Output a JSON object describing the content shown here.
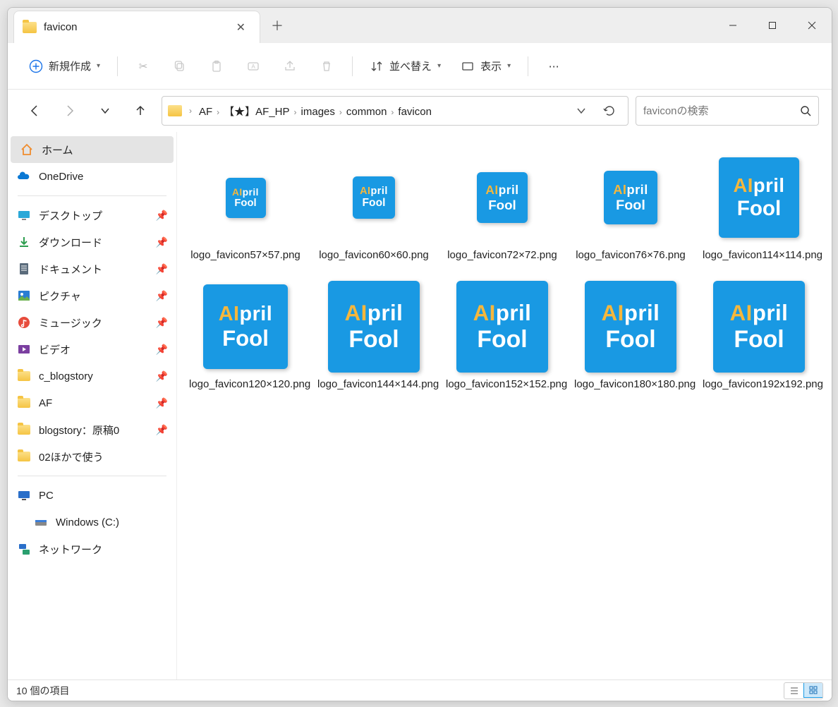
{
  "tab": {
    "title": "favicon"
  },
  "toolbar": {
    "new_label": "新規作成",
    "sort_label": "並べ替え",
    "view_label": "表示"
  },
  "breadcrumb": [
    "AF",
    "【★】AF_HP",
    "images",
    "common",
    "favicon"
  ],
  "search": {
    "placeholder": "faviconの検索"
  },
  "sidebar": {
    "home": "ホーム",
    "onedrive": "OneDrive",
    "quick": [
      {
        "label": "デスクトップ",
        "icon": "desktop",
        "pinned": true
      },
      {
        "label": "ダウンロード",
        "icon": "download",
        "pinned": true
      },
      {
        "label": "ドキュメント",
        "icon": "document",
        "pinned": true
      },
      {
        "label": "ピクチャ",
        "icon": "pictures",
        "pinned": true
      },
      {
        "label": "ミュージック",
        "icon": "music",
        "pinned": true
      },
      {
        "label": "ビデオ",
        "icon": "video",
        "pinned": true
      },
      {
        "label": "c_blogstory",
        "icon": "folder",
        "pinned": true
      },
      {
        "label": "AF",
        "icon": "folder",
        "pinned": true
      },
      {
        "label": "blogstory：原稿0",
        "icon": "folder",
        "pinned": true
      },
      {
        "label": "02ほかで使う",
        "icon": "folder",
        "pinned": false
      }
    ],
    "pc": "PC",
    "drive": "Windows (C:)",
    "network": "ネットワーク"
  },
  "files": [
    {
      "name": "logo_favicon57×57.png",
      "size": 57
    },
    {
      "name": "logo_favicon60×60.png",
      "size": 60
    },
    {
      "name": "logo_favicon72×72.png",
      "size": 72
    },
    {
      "name": "logo_favicon76×76.png",
      "size": 76
    },
    {
      "name": "logo_favicon114×114.png",
      "size": 114
    },
    {
      "name": "logo_favicon120×120.png",
      "size": 120
    },
    {
      "name": "logo_favicon144×144.png",
      "size": 130
    },
    {
      "name": "logo_favicon152×152.png",
      "size": 130
    },
    {
      "name": "logo_favicon180×180.png",
      "size": 130
    },
    {
      "name": "logo_favicon192x192.png",
      "size": 130
    }
  ],
  "status": {
    "count": "10 個の項目"
  },
  "logo": {
    "line1a": "AI",
    "line1b": "pril",
    "line2": "Fool"
  }
}
